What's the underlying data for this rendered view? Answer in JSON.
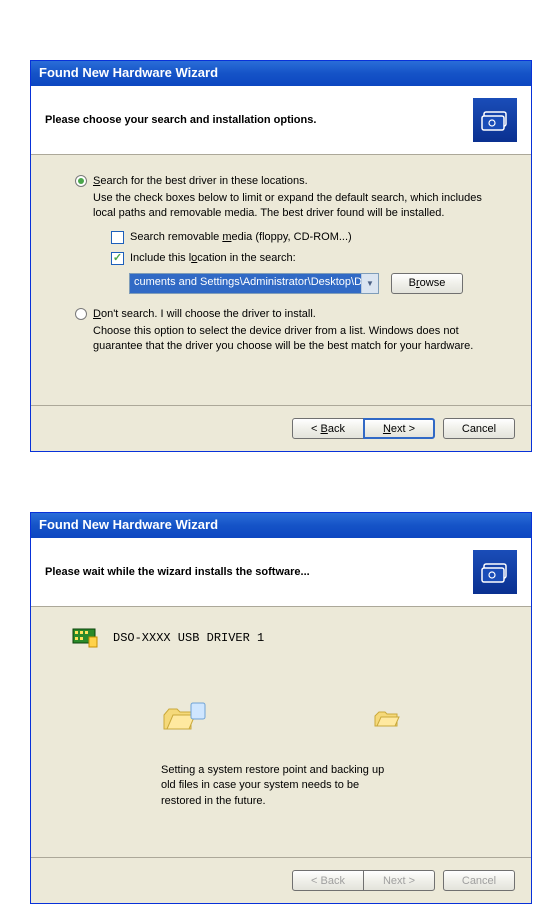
{
  "dialog1": {
    "title": "Found New Hardware Wizard",
    "header": "Please choose your search and installation options.",
    "option_search": {
      "label_pre": "S",
      "label_rest": "earch for the best driver in these locations.",
      "desc": "Use the check boxes below to limit or expand the default search, which includes local paths and removable media. The best driver found will be installed.",
      "cb_removable_pre": "Search removable ",
      "cb_removable_ul": "m",
      "cb_removable_post": "edia (floppy, CD-ROM...)",
      "cb_include_pre": "Include this l",
      "cb_include_ul": "o",
      "cb_include_post": "cation in the search:",
      "path": "cuments and Settings\\Administrator\\Desktop\\Driver",
      "browse_pre": "B",
      "browse_ul": "r",
      "browse_post": "owse"
    },
    "option_dont": {
      "label_pre": "D",
      "label_rest": "on't search. I will choose the driver to install.",
      "desc": "Choose this option to select the device driver from a list.  Windows does not guarantee that the driver you choose will be the best match for your hardware."
    },
    "buttons": {
      "back_pre": "< ",
      "back_ul": "B",
      "back_post": "ack",
      "next_ul": "N",
      "next_post": "ext >",
      "cancel": "Cancel"
    }
  },
  "dialog2": {
    "title": "Found New Hardware Wizard",
    "header": "Please wait while the wizard installs the software...",
    "device": "DSO-XXXX USB DRIVER 1",
    "status": "Setting a system restore point and backing up old files in case your system needs to be restored in the future.",
    "buttons": {
      "back": "< Back",
      "next": "Next >",
      "cancel": "Cancel"
    }
  }
}
